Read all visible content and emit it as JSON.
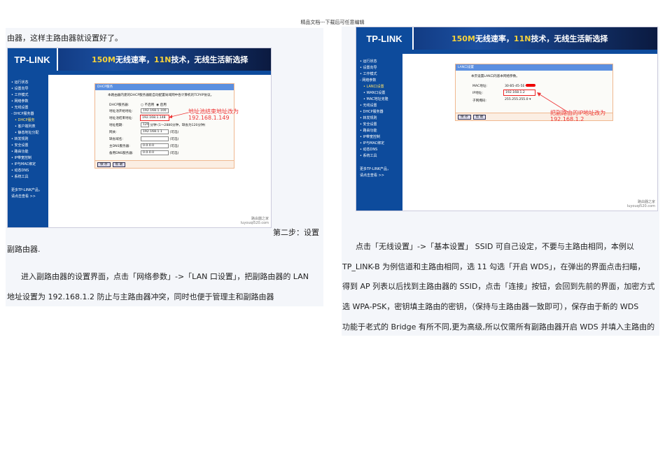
{
  "header": "精品文档---下载后可任意编辑",
  "left": {
    "p1": "由器，这样主路由器就设置好了。",
    "p2": "第二步：设置",
    "p3": "副路由器.",
    "p4": "进入副路由器的设置界面，点击「网络参数」->「LAN 口设置」，把副路由器的 LAN",
    "p5": "地址设置为 192.168.1.2 防止与主路由器冲突，同时也便于管理主和副路由器"
  },
  "right": {
    "p1": "点击「无线设置」->「基本设置」 SSID 可自己设定，不要与主路由相同，本例以",
    "p2": "TP_LINK-B 为例信道和主路由相同，选 11 勾选「开启 WDS」，在弹出的界面点击扫瞄，",
    "p3": "得到 AP 列表以后找到主路由器的 SSID，点击「连接」按钮，会回到先前的界面，加密方式",
    "p4": "选 WPA-PSK，密钥填主路由的密钥，（保持与主路由器一致即可），保存由于新的 WDS",
    "p5": "功能于老式的 Bridge 有所不同,更为高级,所以仅需所有副路由器开启 WDS 并填入主路由的"
  },
  "router": {
    "logo": "TP-LINK",
    "slogan_a": "150M",
    "slogan_b": "无线速率，",
    "slogan_c": "11N",
    "slogan_d": "技术，无线生活新选择",
    "more1": "更多TP-LINK产品，",
    "more2": "请点击查看 >>",
    "save": "保 存",
    "help": "帮 助",
    "wm1": "路由器之家",
    "wm2": "luyouqi520.com"
  },
  "shot1": {
    "menu": [
      "• 运行状态",
      "• 设置向导",
      "• 工作模式",
      "• 网络参数",
      "• 无线设置",
      "- DHCP服务器"
    ],
    "sub": [
      "• DHCP服务",
      "• 客户端列表",
      "• 静态地址分配"
    ],
    "menu2": [
      "• 转发规则",
      "• 安全设置",
      "• 路由功能",
      "• IP带宽控制",
      "• IP与MAC绑定",
      "• 动态DNS",
      "• 系统工具"
    ],
    "title": "DHCP服务",
    "desc": "本路由器内建的DHCP服务器能自动配置局域网中各计算机的TCP/IP协议。",
    "f_dhcp": "DHCP服务器:",
    "off": "不启用",
    "on": "启用",
    "f_start": "地址池开始地址:",
    "v_start": "192.168.1.100",
    "f_end": "地址池结束地址:",
    "v_end": "192.168.1.148",
    "f_lease": "地址租期:",
    "v_lease": "120",
    "lease_hint": "分钟 (1～2880分钟，缺省为120分钟)",
    "f_gw": "网关:",
    "v_gw": "192.168.1.1",
    "f_domain": "缺省域名:",
    "f_dns1": "主DNS服务器:",
    "v_dns1": "0.0.0.0",
    "f_dns2": "备用DNS服务器:",
    "v_dns2": "0.0.0.0",
    "optional": "(可选)",
    "note1": "地址池结束地址改为",
    "note2": "192.168.1.149"
  },
  "shot2": {
    "menu": [
      "• 运行状态",
      "• 设置向导",
      "• 工作模式",
      "- 网络参数"
    ],
    "sub": [
      "• LAN口设置",
      "• WAN口设置",
      "• MAC地址克隆"
    ],
    "menu2": [
      "• 无线设置",
      "• DHCP服务器",
      "• 转发规则",
      "• 安全设置",
      "• 路由功能",
      "• IP带宽控制",
      "• IP与MAC绑定",
      "• 动态DNS",
      "• 系统工具"
    ],
    "title": "LAN口设置",
    "desc": "本页设置LAN口的基本网络参数。",
    "f_mac": "MAC地址:",
    "v_mac": "30-B5-45-5E-",
    "f_ip": "IP地址:",
    "v_ip": "192.168.1.2",
    "f_mask": "子网掩码:",
    "v_mask": "255.255.255.0 ▾",
    "note1": "把副路由的IP地址改为",
    "note2": "192.168.1.2"
  }
}
